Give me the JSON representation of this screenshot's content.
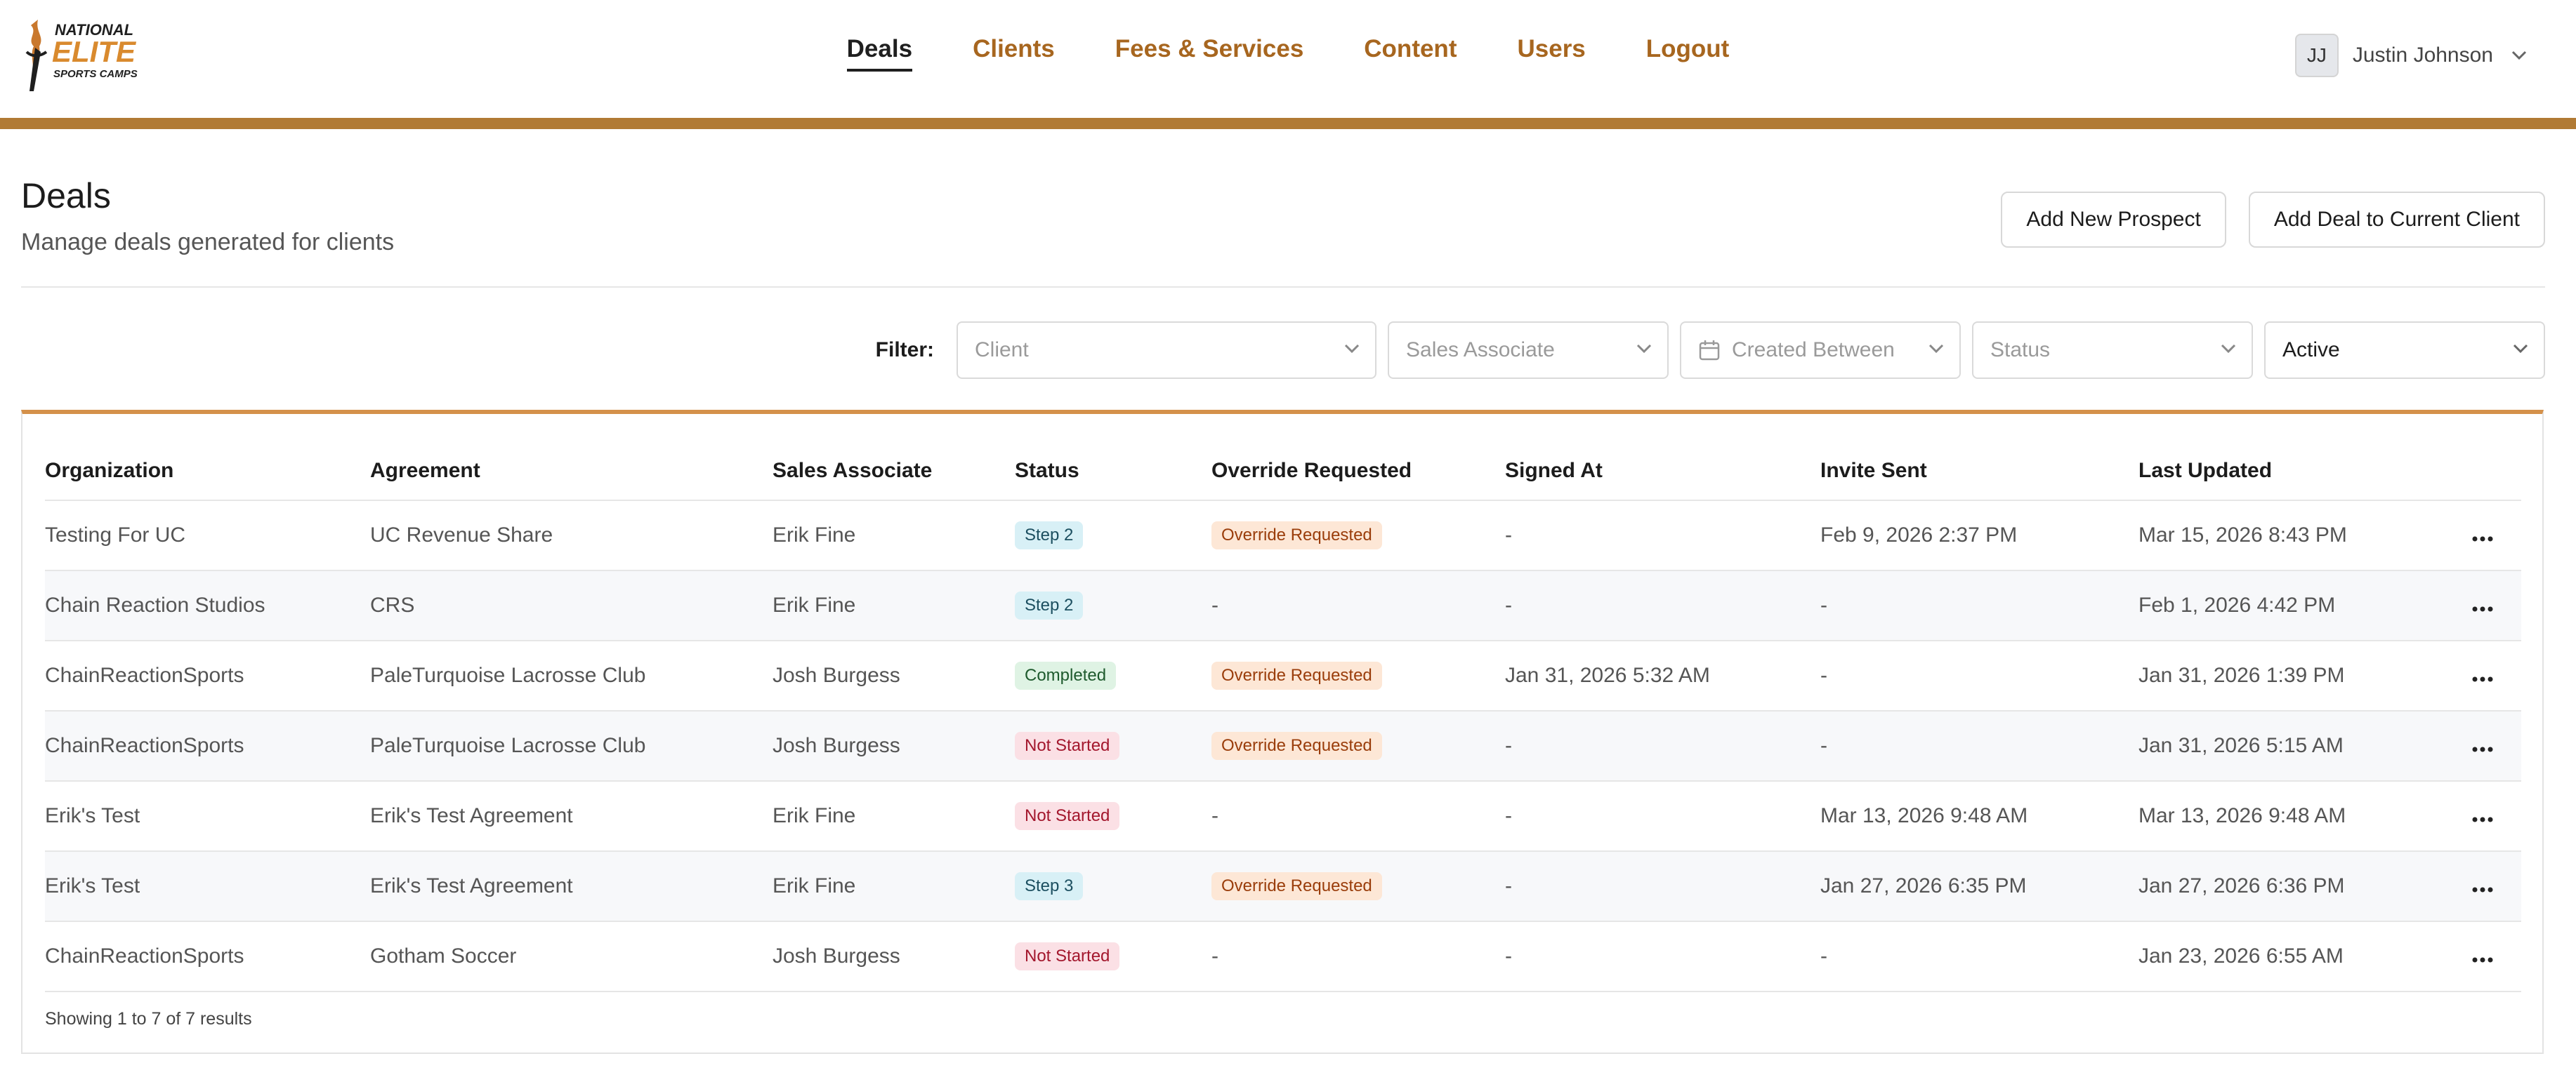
{
  "brand": {
    "line1": "NATIONAL",
    "line2": "ELITE",
    "line3": "SPORTS CAMPS"
  },
  "nav": [
    {
      "label": "Deals",
      "active": true
    },
    {
      "label": "Clients"
    },
    {
      "label": "Fees & Services"
    },
    {
      "label": "Content"
    },
    {
      "label": "Users"
    },
    {
      "label": "Logout"
    }
  ],
  "user": {
    "initials": "JJ",
    "name": "Justin Johnson"
  },
  "page": {
    "title": "Deals",
    "subtitle": "Manage deals generated for clients"
  },
  "actions": {
    "add_prospect": "Add New Prospect",
    "add_deal": "Add Deal to Current Client"
  },
  "filters": {
    "label": "Filter:",
    "client": "Client",
    "sales_associate": "Sales Associate",
    "created_between": "Created Between",
    "status": "Status",
    "active": "Active"
  },
  "table": {
    "headers": [
      "Organization",
      "Agreement",
      "Sales Associate",
      "Status",
      "Override Requested",
      "Signed At",
      "Invite Sent",
      "Last Updated"
    ],
    "rows": [
      {
        "organization": "Testing For UC",
        "agreement": "UC Revenue Share",
        "associate": "Erik Fine",
        "status": "Step 2",
        "override": "Override Requested",
        "signed": "-",
        "invite": "Feb 9, 2026 2:37 PM",
        "updated": "Mar 15, 2026 8:43 PM"
      },
      {
        "organization": "Chain Reaction Studios",
        "agreement": "CRS",
        "associate": "Erik Fine",
        "status": "Step 2",
        "override": "-",
        "signed": "-",
        "invite": "-",
        "updated": "Feb 1, 2026 4:42 PM"
      },
      {
        "organization": "ChainReactionSports",
        "agreement": "PaleTurquoise Lacrosse Club",
        "associate": "Josh Burgess",
        "status": "Completed",
        "override": "Override Requested",
        "signed": "Jan 31, 2026 5:32 AM",
        "invite": "-",
        "updated": "Jan 31, 2026 1:39 PM"
      },
      {
        "organization": "ChainReactionSports",
        "agreement": "PaleTurquoise Lacrosse Club",
        "associate": "Josh Burgess",
        "status": "Not Started",
        "override": "Override Requested",
        "signed": "-",
        "invite": "-",
        "updated": "Jan 31, 2026 5:15 AM"
      },
      {
        "organization": "Erik's Test",
        "agreement": "Erik's Test Agreement",
        "associate": "Erik Fine",
        "status": "Not Started",
        "override": "-",
        "signed": "-",
        "invite": "Mar 13, 2026 9:48 AM",
        "updated": "Mar 13, 2026 9:48 AM"
      },
      {
        "organization": "Erik's Test",
        "agreement": "Erik's Test Agreement",
        "associate": "Erik Fine",
        "status": "Step 3",
        "override": "Override Requested",
        "signed": "-",
        "invite": "Jan 27, 2026 6:35 PM",
        "updated": "Jan 27, 2026 6:36 PM"
      },
      {
        "organization": "ChainReactionSports",
        "agreement": "Gotham Soccer",
        "associate": "Josh Burgess",
        "status": "Not Started",
        "override": "-",
        "signed": "-",
        "invite": "-",
        "updated": "Jan 23, 2026 6:55 AM"
      }
    ],
    "footer": "Showing 1 to 7 of 7 results"
  },
  "colors": {
    "accent": "#b17a34",
    "nav_link": "#a7661f",
    "table_top_border": "#d4914a"
  },
  "icons": {
    "row_menu": "more-horizontal-icon",
    "dropdown": "chevron-down-icon",
    "calendar": "calendar-icon"
  }
}
